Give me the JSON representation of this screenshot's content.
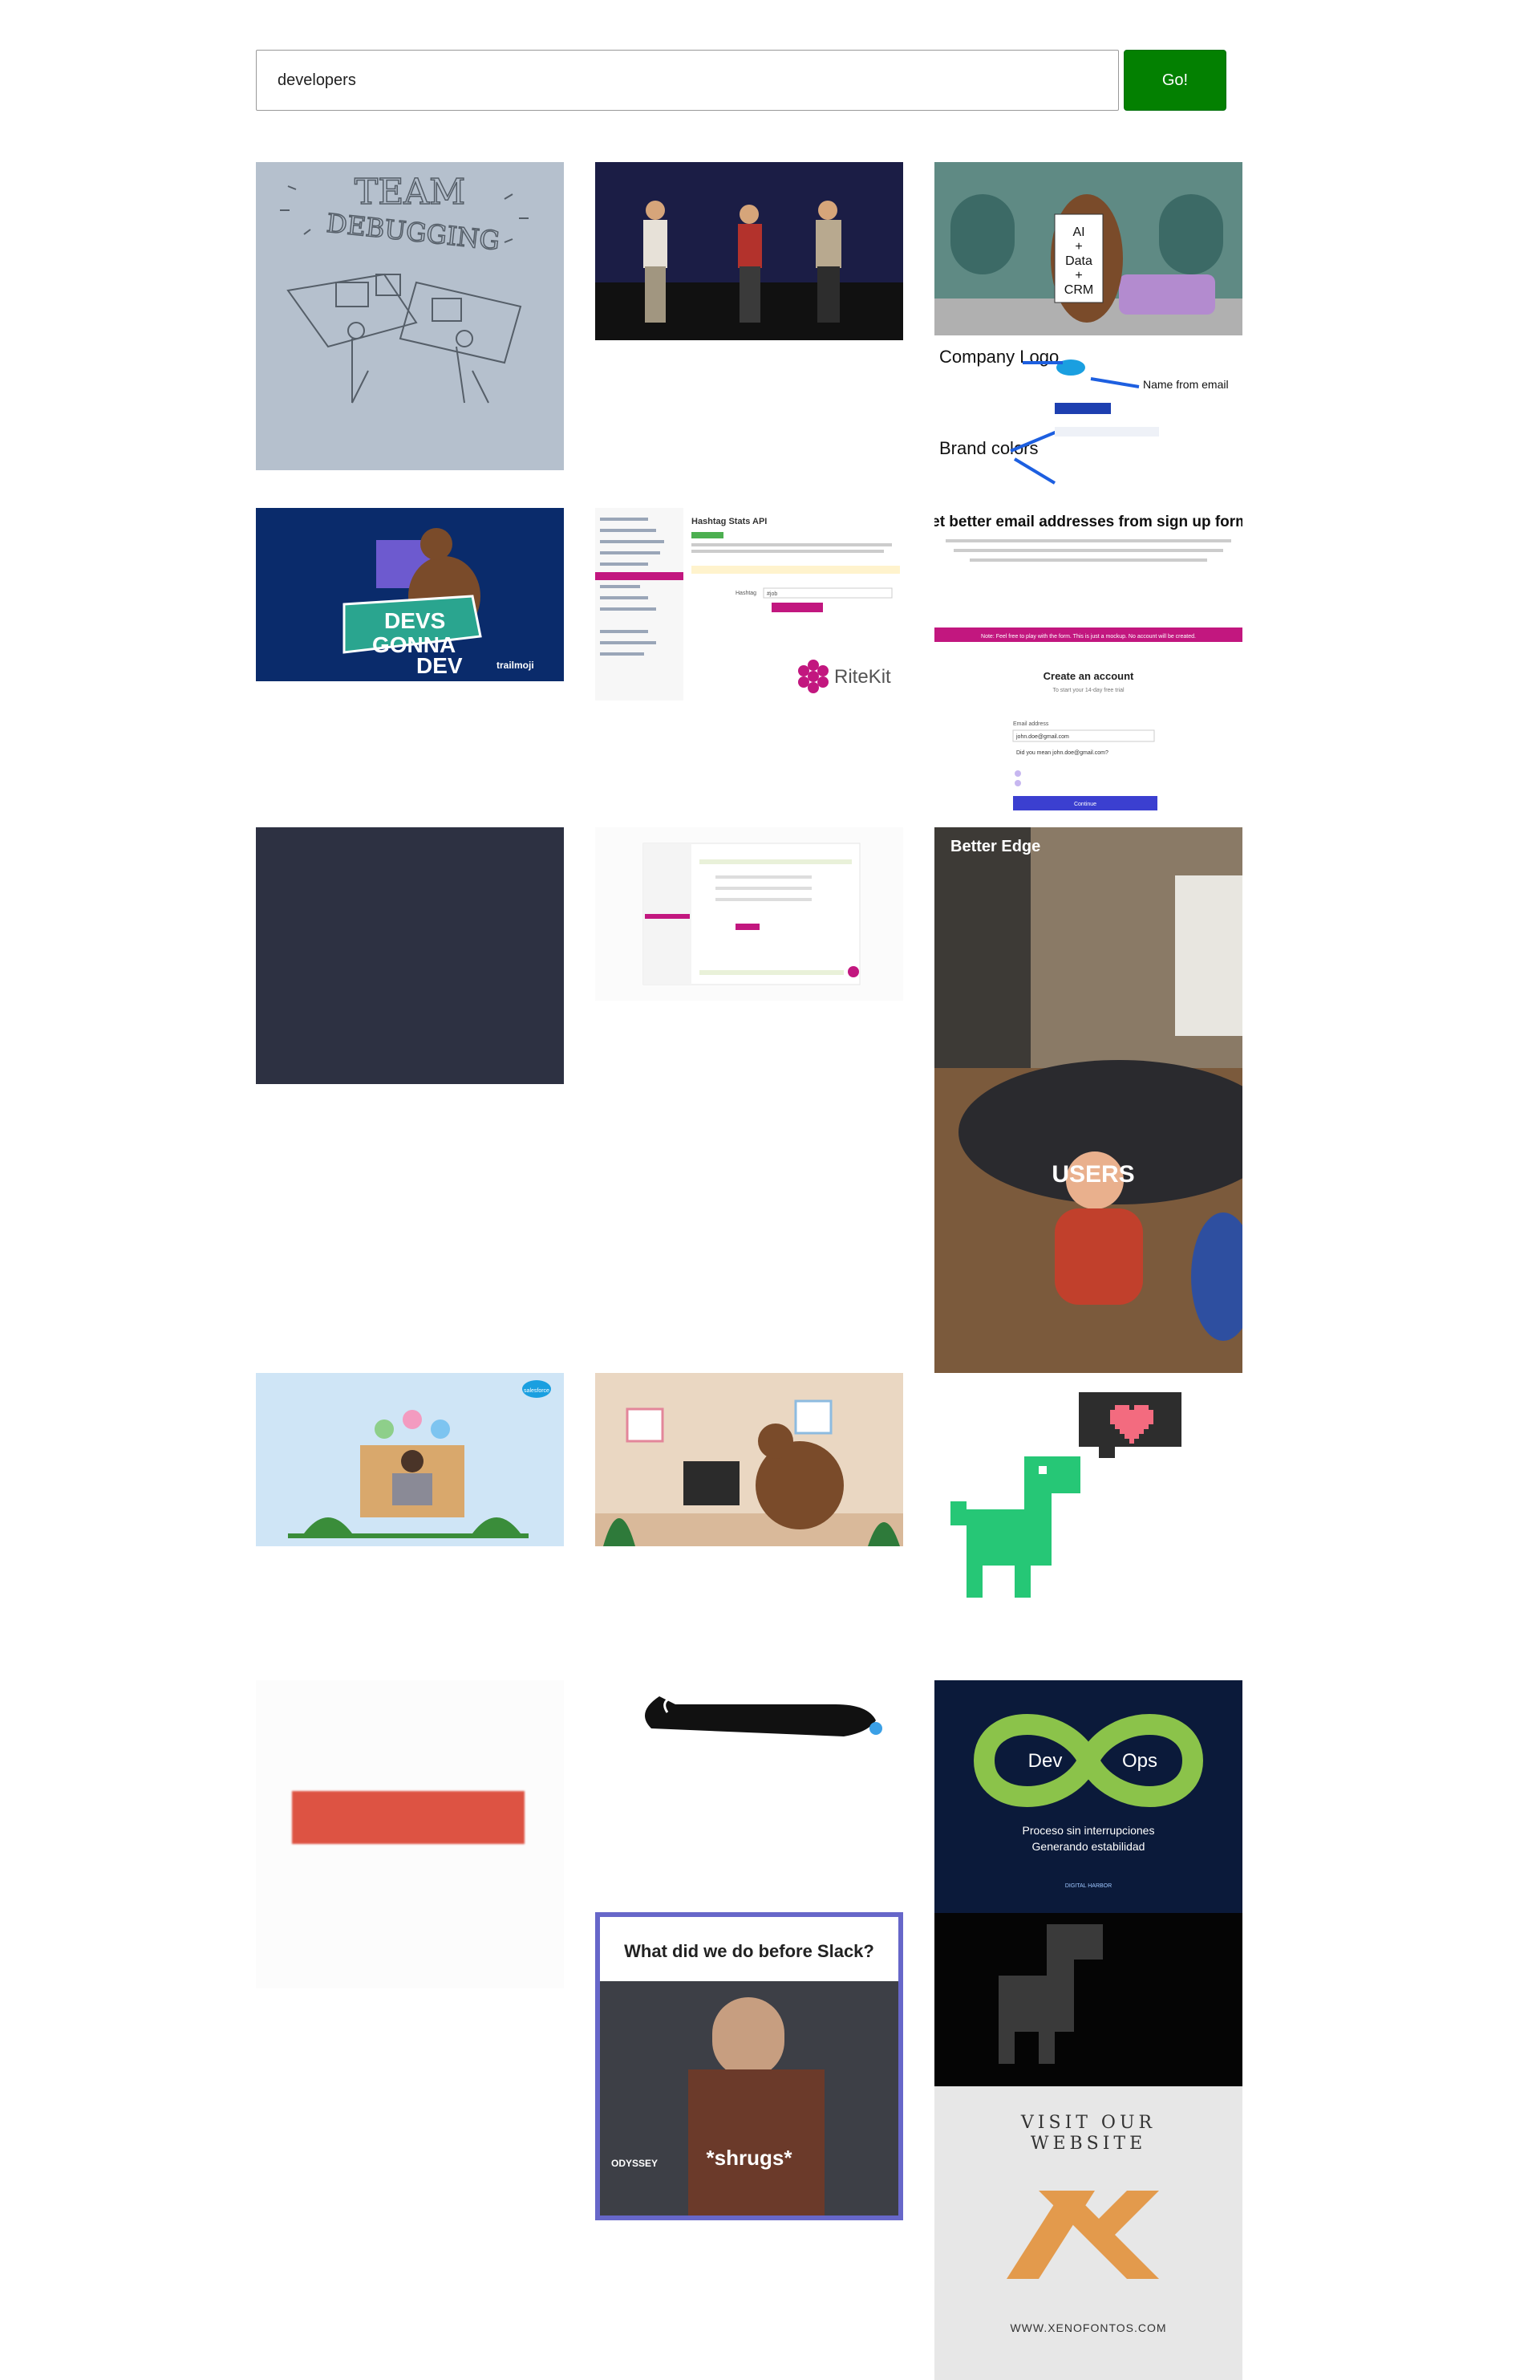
{
  "search": {
    "query": "developers",
    "button_label": "Go!"
  },
  "colors": {
    "go_button": "#038001",
    "background": "#ffffff"
  },
  "results": {
    "gif_1": {
      "line1": "TEAM",
      "line2": "DEBUGGING"
    },
    "gif_2": {
      "alt": "three men dancing on stage"
    },
    "gif_3": {
      "sign_lines": [
        "AI",
        "+",
        "Data",
        "+",
        "CRM"
      ],
      "company_logo": "Company Logo",
      "name_from_email": "Name from email",
      "brand_colors": "Brand colors",
      "headline": "Get better email addresses from sign up forms",
      "body": "Use RiteKit API to prevent email typos, block disposable email accounts or require a business email address that can be further used in RiteKit API for tailoring your web or mobile app to the user.",
      "notice": "Note: Feel free to play with the form. This is just a mockup. No account will be created.",
      "form_title": "Create an account",
      "form_subtitle": "To start your 14-day free trial",
      "email_label": "Email address",
      "email_value": "john.doe@gmail.com",
      "suggestion": "Did you mean john.doe@gmail.com?",
      "button": "Continue"
    },
    "gif_4": {
      "line1": "DEVS",
      "line2": "GONNA",
      "line3": "DEV",
      "brand": "trailmoji"
    },
    "gif_5": {
      "title": "Hashtag Stats API",
      "field_label": "Hashtag",
      "field_value": "#job",
      "brand": "RiteKit"
    },
    "gif_6": {
      "alt": "dark slate placeholder"
    },
    "gif_7": {
      "alt": "RiteKit dashboard screencast"
    },
    "gif_8": {
      "watermark": "Better Edge",
      "label": "USERS"
    },
    "gif_9": {
      "brand": "salesforce"
    },
    "gif_10": {
      "alt": "bear working at desk"
    },
    "gif_11": {
      "alt": "pixel dinosaur with heart"
    },
    "gif_12": {
      "alt": "red bar"
    },
    "gif_13": {
      "alt": "stretched cat"
    },
    "gif_14": {
      "left": "Dev",
      "right": "Ops",
      "line1": "Proceso sin interrupciones",
      "line2": "Generando estabilidad",
      "brand": "DIGITAL HARBOR"
    },
    "gif_15": {
      "title": "What did we do before Slack?",
      "caption": "*shrugs*",
      "badge": "ODYSSEY"
    },
    "gif_16": {
      "alt": "pixel dinosaur on black"
    },
    "gif_17": {
      "line1": "VISIT OUR",
      "line2": "WEBSITE",
      "url": "WWW.XENOFONTOS.COM"
    }
  }
}
